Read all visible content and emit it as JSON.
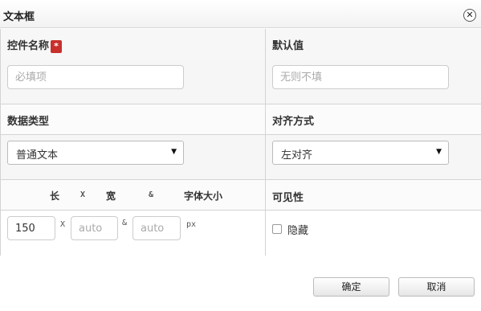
{
  "dialog": {
    "title": "文本框",
    "close_glyph": "✕"
  },
  "fields": {
    "name_label": "控件名称",
    "required_mark": "*",
    "name_placeholder": "必填项",
    "default_label": "默认值",
    "default_placeholder": "无则不填",
    "data_type_label": "数据类型",
    "data_type_value": "普通文本",
    "align_label": "对齐方式",
    "align_value": "左对齐"
  },
  "size": {
    "length_label": "长",
    "x_sym_header": "X",
    "width_label": "宽",
    "amp_sym_header": "&",
    "font_size_label": "字体大小",
    "length_value": "150",
    "x_sym": "X",
    "width_placeholder": "auto",
    "amp_sym": "&",
    "font_placeholder": "auto",
    "unit": "px"
  },
  "visibility": {
    "label": "可见性",
    "hidden_label": "隐藏",
    "hidden_checked": false
  },
  "buttons": {
    "ok": "确定",
    "cancel": "取消"
  },
  "icons": {
    "close": "close-icon",
    "dropdown": "caret-down-icon",
    "select_arrow_glyph": "▼"
  }
}
